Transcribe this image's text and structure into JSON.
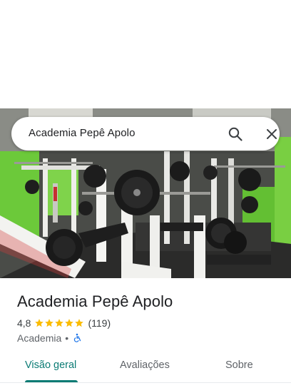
{
  "search": {
    "query": "Academia Pepê Apolo"
  },
  "place": {
    "name": "Academia Pepê Apolo",
    "rating": "4,8",
    "stars": 4.8,
    "reviews": "(119)",
    "category": "Academia",
    "separator": "•"
  },
  "tabs": [
    {
      "label": "Visão geral",
      "active": true
    },
    {
      "label": "Avaliações",
      "active": false
    },
    {
      "label": "Sobre",
      "active": false
    }
  ],
  "colors": {
    "accent": "#0b7b74",
    "star": "#fbbc04",
    "accessibility": "#1a73e8",
    "wall_green": "#6cc93a"
  },
  "icons": {
    "search": "search-icon",
    "close": "close-icon",
    "wheelchair": "wheelchair-icon",
    "star": "star-icon"
  }
}
